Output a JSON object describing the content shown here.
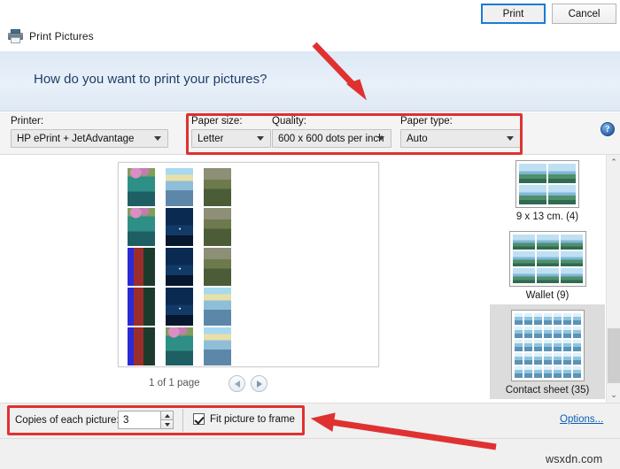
{
  "window": {
    "app_title": "Print Pictures",
    "app_icon": "printer-icon",
    "close_label": "✕"
  },
  "banner": {
    "heading": "How do you want to print your pictures?"
  },
  "toolbar": {
    "help_label": "?",
    "fields": [
      {
        "label": "Printer:",
        "value": "HP ePrint + JetAdvantage"
      },
      {
        "label": "Paper size:",
        "value": "Letter"
      },
      {
        "label": "Quality:",
        "value": "600 x 600 dots per inch"
      },
      {
        "label": "Paper type:",
        "value": "Auto"
      }
    ]
  },
  "preview": {
    "page_counter": "1 of 1 page",
    "prev_label": "Previous page",
    "next_label": "Next page",
    "thumbnails": [
      "flower",
      "sunset",
      "tree",
      "flower",
      "night",
      "tree",
      "red",
      "night",
      "tree",
      "red",
      "night",
      "sunset",
      "red",
      "flower",
      "sunset"
    ]
  },
  "layouts": {
    "items": [
      {
        "label": "9 x 13 cm. (4)",
        "cells": 4,
        "selected": false
      },
      {
        "label": "Wallet (9)",
        "cells": 9,
        "selected": false
      },
      {
        "label": "Contact sheet (35)",
        "cells": 35,
        "selected": true
      }
    ],
    "scroll_up": "⌃",
    "scroll_down": "⌄"
  },
  "bottom": {
    "copies_label": "Copies of each picture:",
    "copies_value": "3",
    "fit_label": "Fit picture to frame",
    "fit_checked": true,
    "options_link": "Options..."
  },
  "footer": {
    "print_label": "Print",
    "cancel_label": "Cancel"
  },
  "watermark": {
    "text": "wsxdn.com"
  },
  "annotations": {
    "accent_color": "#e03131",
    "arrow_top_label": "arrow pointing to paper settings",
    "arrow_bottom_label": "arrow pointing to copies settings"
  }
}
